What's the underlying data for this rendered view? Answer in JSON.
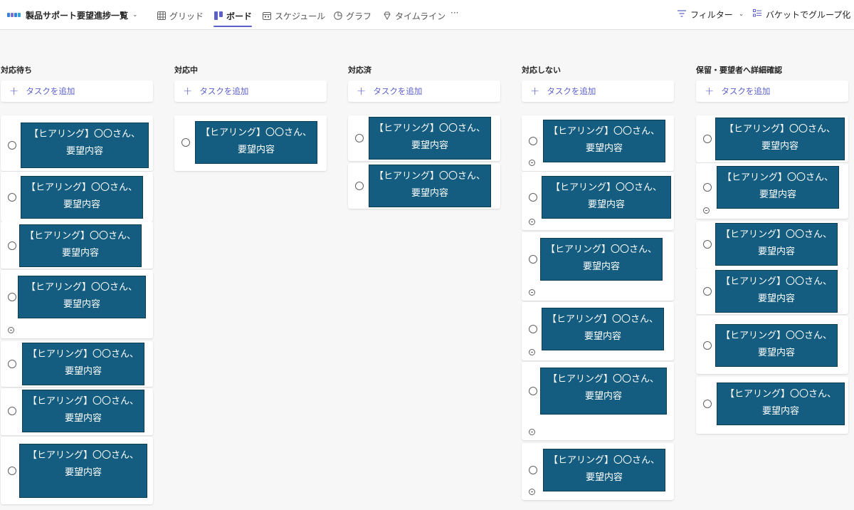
{
  "plan": {
    "title": "製品サポート要望進捗一覧"
  },
  "tabs": [
    {
      "label": "グリッド",
      "icon": "grid-icon"
    },
    {
      "label": "ボード",
      "icon": "board-icon"
    },
    {
      "label": "スケジュール",
      "icon": "calendar-icon"
    },
    {
      "label": "グラフ",
      "icon": "chart-icon"
    },
    {
      "label": "タイムライン",
      "icon": "diamond-icon"
    }
  ],
  "toolbar": {
    "more": "···",
    "filter_label": "フィルター",
    "group_label": "バケットでグループ化"
  },
  "add_task_label": "タスクを追加",
  "card_line1": "【ヒアリング】〇〇さん、",
  "card_line2": "要望内容",
  "buckets": [
    {
      "name": "対応待ち",
      "cards": 7
    },
    {
      "name": "対応中",
      "cards": 1
    },
    {
      "name": "対応済",
      "cards": 2
    },
    {
      "name": "対応しない",
      "cards": 6
    },
    {
      "name": "保留・要望者へ詳細確認",
      "cards": 6
    }
  ],
  "colors": {
    "accent": "#5b5fc7",
    "thumbnail": "#145d80"
  }
}
